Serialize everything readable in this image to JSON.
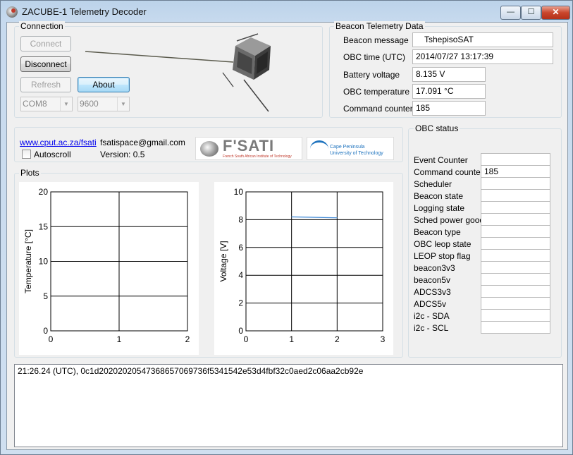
{
  "window": {
    "title": "ZACUBE-1 Telemetry Decoder",
    "min_glyph": "—",
    "max_glyph": "☐",
    "close_glyph": "✕"
  },
  "connection": {
    "title": "Connection",
    "connect_label": "Connect",
    "disconnect_label": "Disconnect",
    "refresh_label": "Refresh",
    "about_label": "About",
    "port_value": "COM8",
    "baud_value": "9600"
  },
  "beacon": {
    "title": "Beacon Telemetry Data",
    "fields": [
      {
        "label": "Beacon message",
        "value": "TshepisoSAT"
      },
      {
        "label": "OBC time (UTC)",
        "value": "2014/07/27 13:17:39"
      },
      {
        "label": "Battery voltage",
        "value": "8.135 V"
      },
      {
        "label": "OBC temperature",
        "value": "17.091 °C"
      },
      {
        "label": "Command counter",
        "value": "185"
      }
    ]
  },
  "info": {
    "website": "www.cput.ac.za/fsati",
    "email": "fsatispace@gmail.com",
    "autoscroll_label": "Autoscroll",
    "version": "Version: 0.5",
    "fsati_logo_text": "F'SATI",
    "fsati_logo_sub": "French South African Institute of Technology",
    "cput_logo_line1": "Cape Peninsula",
    "cput_logo_line2": "University of Technology"
  },
  "plots": {
    "title": "Plots"
  },
  "chart_data": [
    {
      "type": "line",
      "ylabel": "Temperature [°C]",
      "xlim": [
        0,
        2
      ],
      "ylim": [
        0,
        20
      ],
      "x_ticks": [
        "0",
        "1",
        "2"
      ],
      "y_ticks": [
        "0",
        "5",
        "10",
        "15",
        "20"
      ],
      "grid": true,
      "series": []
    },
    {
      "type": "line",
      "ylabel": "Voltage [V]",
      "xlim": [
        0,
        3
      ],
      "ylim": [
        0,
        10
      ],
      "x_ticks": [
        "0",
        "1",
        "2",
        "3"
      ],
      "y_ticks": [
        "0",
        "2",
        "4",
        "6",
        "8",
        "10"
      ],
      "grid": true,
      "series": [
        {
          "x": [
            1,
            2
          ],
          "y": [
            8.2,
            8.135
          ],
          "color": "#4a90d9"
        }
      ]
    }
  ],
  "obc_status": {
    "title": "OBC status",
    "rows": [
      {
        "label": "Event Counter",
        "value": ""
      },
      {
        "label": "Command counter",
        "value": "185"
      },
      {
        "label": "Scheduler",
        "value": ""
      },
      {
        "label": "Beacon state",
        "value": ""
      },
      {
        "label": "Logging state",
        "value": ""
      },
      {
        "label": "Sched power good",
        "value": ""
      },
      {
        "label": "Beacon type",
        "value": ""
      },
      {
        "label": "OBC leop state",
        "value": ""
      },
      {
        "label": "LEOP stop flag",
        "value": ""
      },
      {
        "label": "beacon3v3",
        "value": ""
      },
      {
        "label": "beacon5v",
        "value": ""
      },
      {
        "label": "ADCS3v3",
        "value": ""
      },
      {
        "label": "ADCS5v",
        "value": ""
      },
      {
        "label": "i2c - SDA",
        "value": ""
      },
      {
        "label": "i2c - SCL",
        "value": ""
      }
    ]
  },
  "log": {
    "lines": [
      "21:26.24 (UTC), 0c1d20202020547368657069736f5341542e53d4fbf32c0aed2c06aa2cb92e"
    ]
  }
}
